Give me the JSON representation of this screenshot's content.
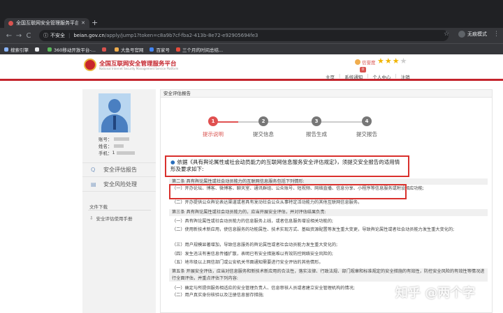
{
  "browser": {
    "tab_title": "全国互联网安全管理服务平台",
    "tab_close": "✕",
    "new_tab": "+",
    "back_icon": "←",
    "forward_icon": "→",
    "reload_icon": "C",
    "security_label": "不安全",
    "url_host": "beian.gov.cn",
    "url_path": "/apply/jump1?token=c8a9b7cf-fba2-413b-8e72-e92905694fe3",
    "star_icon": "☆",
    "incognito_label": "无痕模式",
    "menu_icon": "⋮"
  },
  "bookmarks": [
    {
      "label": "搜索引擎",
      "color": "#8ab4f8"
    },
    {
      "label": "",
      "color": "#e8eaed"
    },
    {
      "label": "360移动开放平台-...",
      "color": "#5cb85c"
    },
    {
      "label": "",
      "color": "#d9534f"
    },
    {
      "label": "大鱼号官网",
      "color": "#f0ad4e"
    },
    {
      "label": "百家号",
      "color": "#4285f4"
    },
    {
      "label": "三个月的时间总结...",
      "color": "#e74c3c"
    }
  ],
  "header": {
    "site_name": "全国互联网安全管理服务平台",
    "site_subtitle": "National Internet Security Management Service Platform",
    "credit_label": "信誉度",
    "stars_on": "★★★",
    "stars_off": "★",
    "notif_count": "0",
    "nav": [
      "主页",
      "系统通知",
      "个人中心",
      "注销"
    ],
    "accent": "#c4242c"
  },
  "sidebar": {
    "account_label": "账号：",
    "name_label": "姓名：",
    "phone_label": "手机：",
    "phone_prefix": "1",
    "items": [
      {
        "label": "安全评估报告",
        "icon": "Q"
      },
      {
        "label": "安全风险处理",
        "icon": "▤"
      }
    ],
    "downloads_title": "文件下载",
    "download_item": "安全评估使用手册",
    "download_icon": "⇩"
  },
  "main": {
    "breadcrumb": "安全评估报告",
    "steps": [
      {
        "num": "1",
        "label": "提示说明"
      },
      {
        "num": "2",
        "label": "提交信息"
      },
      {
        "num": "3",
        "label": "报告生成"
      },
      {
        "num": "4",
        "label": "提交报告"
      }
    ],
    "law_bullet": "●",
    "law_text": "依据《具有舆论属性或社会动员能力的互联网信息服务安全评估规定》，须提交安全报告的适用情形及要求如下:",
    "rows": [
      "第二条 具有舆论属性或社会动员能力的互联网信息服务包括下列情形:",
      "（一）开办论坛、博客、微博客、聊天室、通讯群组、公众账号、短视频、网络直播、信息分享、小程序等信息服务或附设相应功能;",
      "（二）开办提供公众舆论表达渠道或者具有发动社会公众从事特定活动能力的其他互联网信息服务。",
      "第三条 具有舆论属性或社会动员能力的，应当开展安全评估，并对评估结果负责:",
      "（一）具有舆论属性或社会动员能力的信息服务上线，或者信息服务增设相关功能的;",
      "（二）使用新技术新应用，使信息服务的功能属性、技术实现方式、基础资源配置等发生重大变更，导致舆论属性或者社会动员能力发生重大变化的;",
      "（三）用户规模显著增加，导致信息服务的舆论属性或者社会动员能力发生重大变化的;",
      "（四）发生违法有害信息传播扩散，表明已有安全措施难以有效防控网络安全风险的;",
      "（五）地市级以上网信部门或公安机关书面通知需要进行安全评估的其他情形。",
      "第五条 开展安全评估，应当对信息服务和新技术新应用的合法性，落实法律、行政法规、部门规章和标准规定的安全措施的有效性，防控安全风险的有效性等情况进行全面评估，并重点评估下列内容:",
      "（一）确定与所提供服务相适应的安全管理负责人、信息审核人员或者建立安全管理机构的情况;",
      "（二）用户真实身份核验以及注册信息留存措施;"
    ]
  },
  "watermark": "知乎 @两个字"
}
